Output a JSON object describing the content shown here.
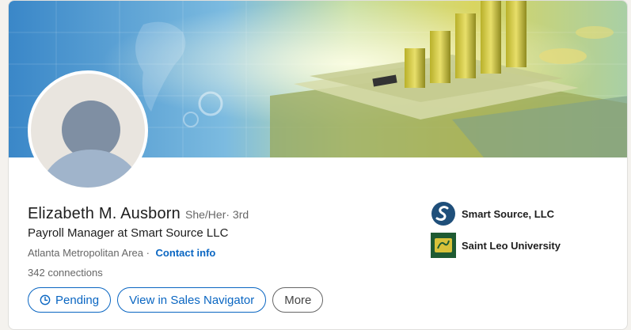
{
  "profile": {
    "name": "Elizabeth M. Ausborn",
    "pronouns": "She/Her",
    "degree": " · 3rd",
    "headline": "Payroll Manager at Smart Source LLC",
    "location": "Atlanta Metropolitan Area ·",
    "contact_info": "Contact info",
    "connections_count": "342",
    "connections_label": "connections"
  },
  "actions": {
    "pending": "Pending",
    "sales_navigator": "View in Sales Navigator",
    "more": "More"
  },
  "organizations": [
    {
      "name": "Smart Source, LLC",
      "icon": "smart-source-logo"
    },
    {
      "name": "Saint Leo University",
      "icon": "saint-leo-logo"
    }
  ],
  "banner": {
    "icon": "finance-money-chart-banner"
  },
  "colors": {
    "link": "#0a66c2",
    "text": "#1d1d1d",
    "muted": "#666666"
  }
}
